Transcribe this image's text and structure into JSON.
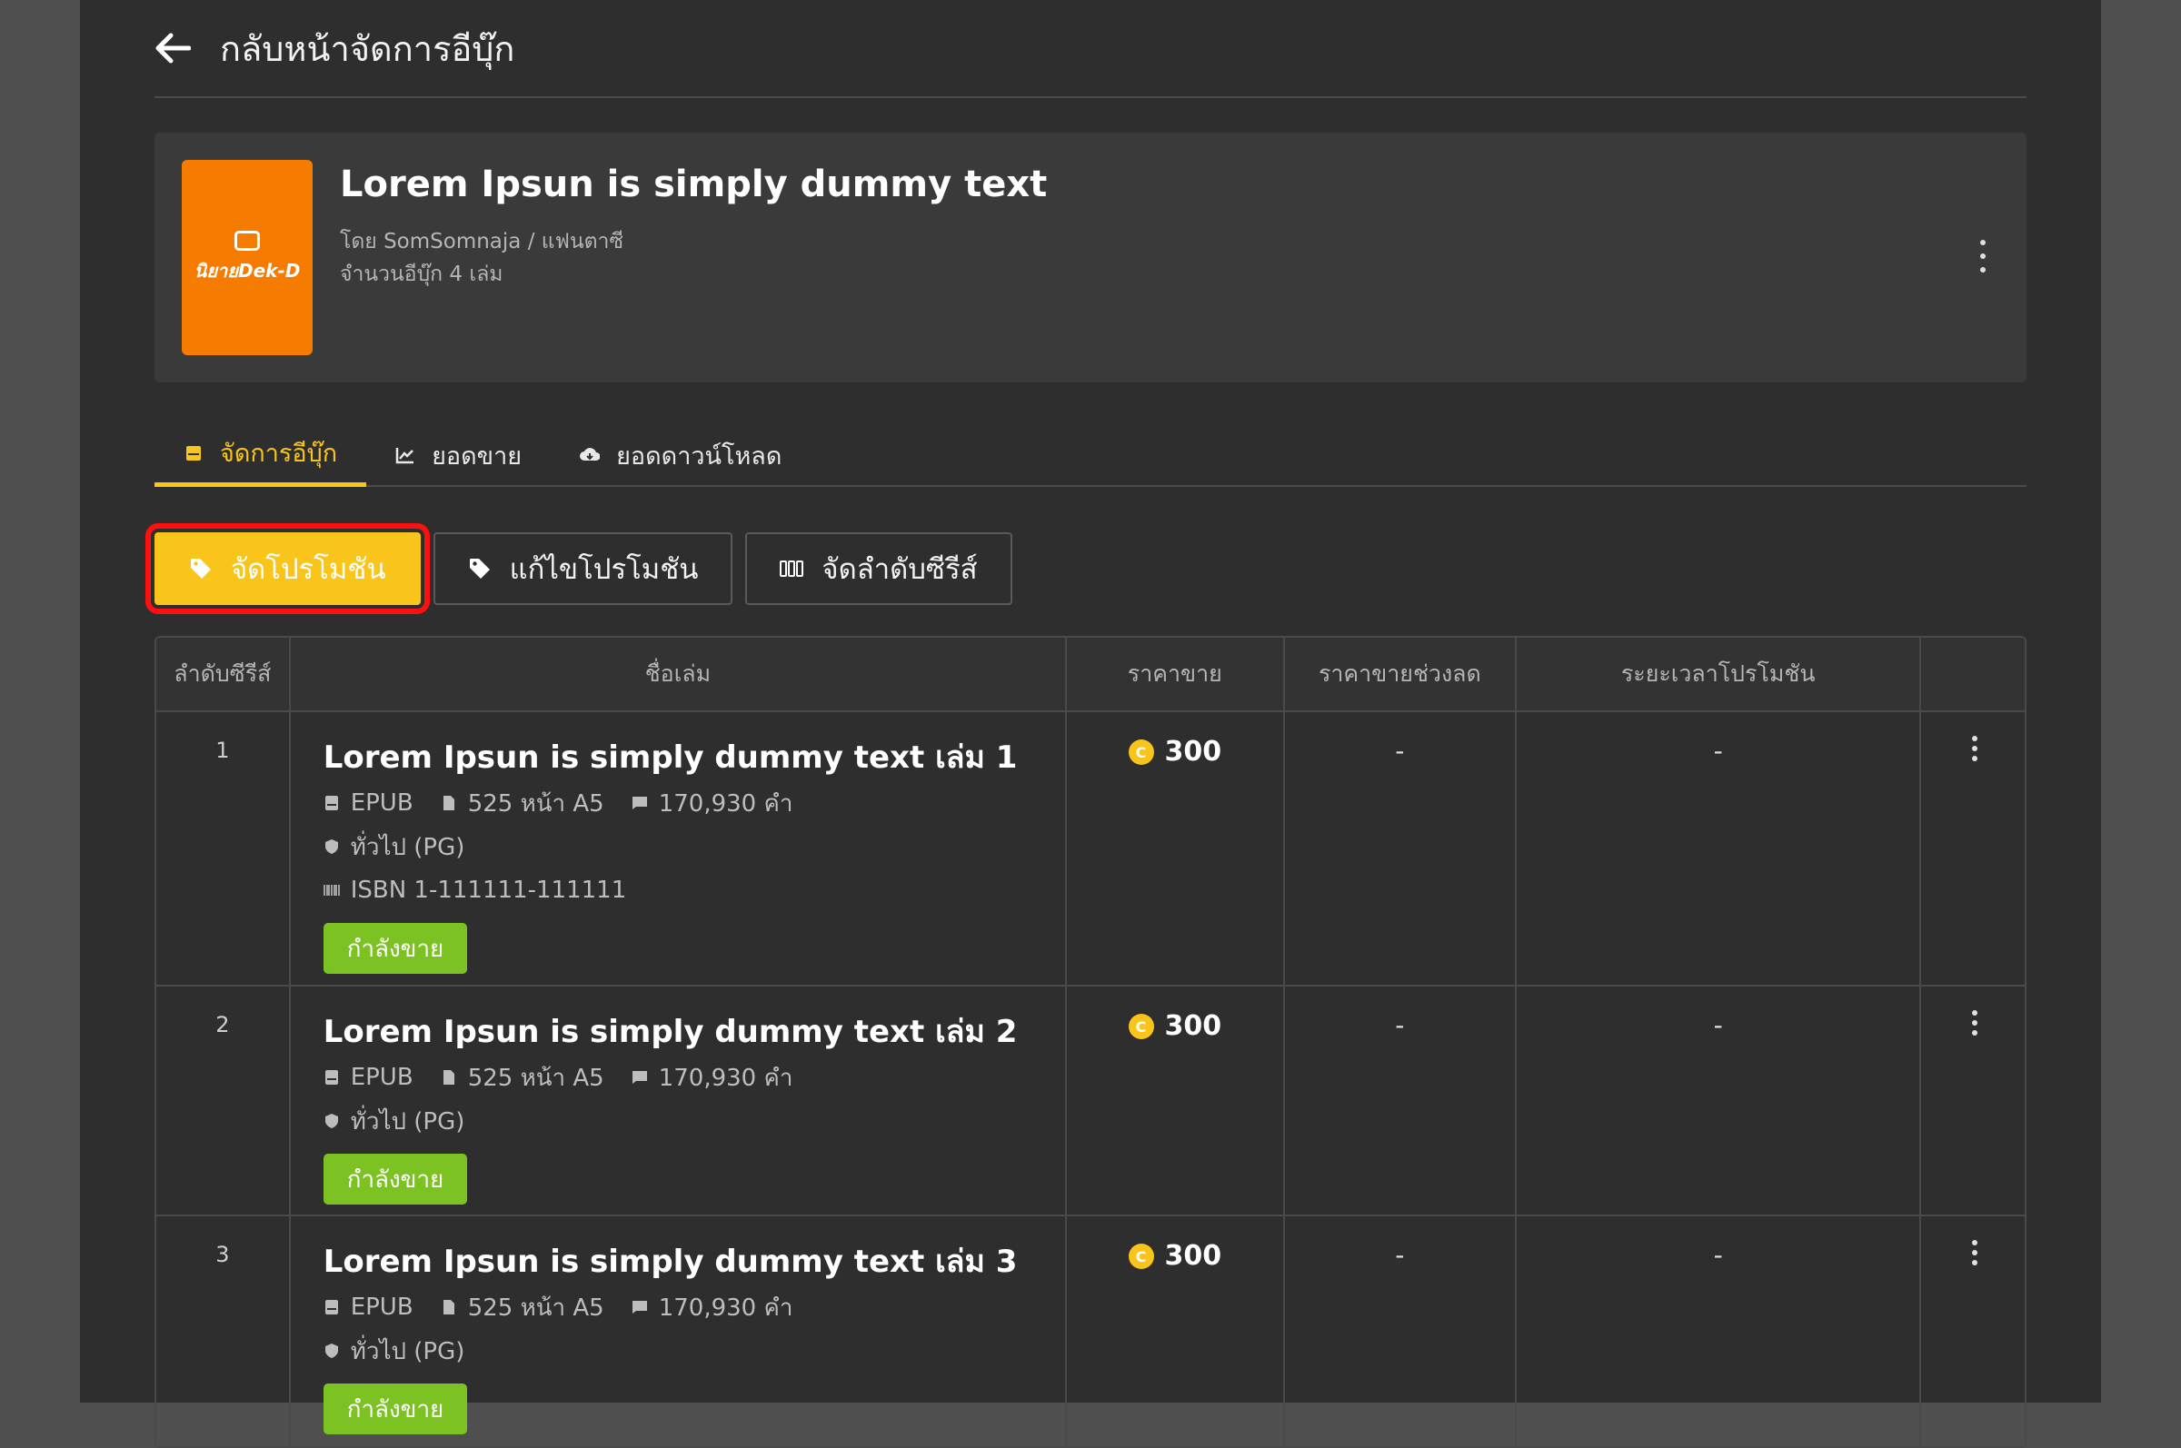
{
  "header": {
    "title": "กลับหน้าจัดการอีบุ๊ก"
  },
  "book": {
    "cover_logo_text": "นิยายDek-D",
    "title": "Lorem Ipsun is simply dummy text",
    "author_line": "โดย SomSomnaja / แฟนตาซี",
    "count_line": "จำนวนอีบุ๊ก 4 เล่ม"
  },
  "tabs": [
    {
      "label": "จัดการอีบุ๊ก",
      "icon": "book-icon",
      "active": true
    },
    {
      "label": "ยอดขาย",
      "icon": "chart-icon",
      "active": false
    },
    {
      "label": "ยอดดาวน์โหลด",
      "icon": "cloud-download-icon",
      "active": false
    }
  ],
  "actions": [
    {
      "label": "จัดโปรโมชัน",
      "icon": "tag-icon",
      "primary": true
    },
    {
      "label": "แก้ไขโปรโมชัน",
      "icon": "tag-icon",
      "primary": false
    },
    {
      "label": "จัดลำดับซีรีส์",
      "icon": "series-order-icon",
      "primary": false
    }
  ],
  "table": {
    "headers": [
      "ลำดับซีรีส์",
      "ชื่อเล่ม",
      "ราคาขาย",
      "ราคาขายช่วงลด",
      "ระยะเวลาโปรโมชัน",
      ""
    ],
    "rows": [
      {
        "order": "1",
        "title": "Lorem Ipsun is simply dummy text เล่ม 1",
        "format": "EPUB",
        "pages": "525 หน้า A5",
        "words": "170,930 คำ",
        "rating": "ทั่วไป (PG)",
        "isbn": "ISBN 1-111111-111111",
        "status": "กำลังขาย",
        "price": "300",
        "discount_price": "-",
        "promo_period": "-"
      },
      {
        "order": "2",
        "title": "Lorem Ipsun is simply dummy text เล่ม 2",
        "format": "EPUB",
        "pages": "525 หน้า A5",
        "words": "170,930 คำ",
        "rating": "ทั่วไป (PG)",
        "status": "กำลังขาย",
        "price": "300",
        "discount_price": "-",
        "promo_period": "-"
      },
      {
        "order": "3",
        "title": "Lorem Ipsun is simply dummy text เล่ม 3",
        "format": "EPUB",
        "pages": "525 หน้า A5",
        "words": "170,930 คำ",
        "rating": "ทั่วไป (PG)",
        "status": "กำลังขาย",
        "price": "300",
        "discount_price": "-",
        "promo_period": "-"
      }
    ]
  },
  "colors": {
    "accent": "#f9c51b",
    "status_green": "#7cc223",
    "cover_orange": "#f57c00",
    "highlight_red": "#ff1010"
  }
}
